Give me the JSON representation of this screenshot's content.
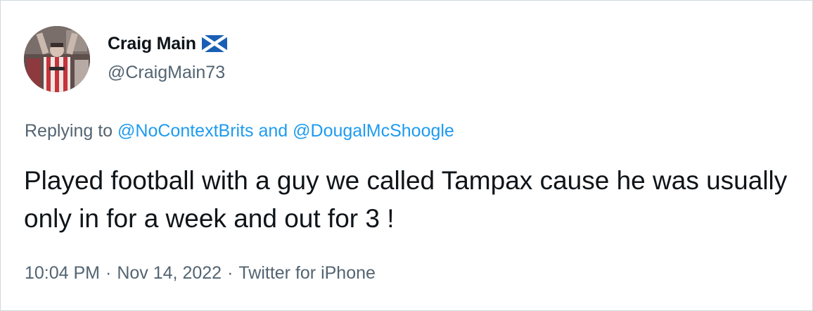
{
  "tweet": {
    "author": {
      "display_name": "Craig Main",
      "flag": "scotland-flag",
      "handle": "@CraigMain73",
      "avatar": "football-player-photo"
    },
    "reply": {
      "prefix": "Replying to",
      "mention_1": "@NoContextBrits",
      "joiner": "and",
      "mention_2": "@DougalMcShoogle"
    },
    "text": "Played football with a guy we called Tampax cause he was usually only in for a week and out for 3 !",
    "meta": {
      "time": "10:04 PM",
      "date": "Nov 14, 2022",
      "source": "Twitter for iPhone",
      "separator": "·"
    },
    "colors": {
      "link": "#1d9bf0",
      "secondary": "#536471",
      "primary": "#0f1419",
      "border": "#cfd9de"
    }
  }
}
